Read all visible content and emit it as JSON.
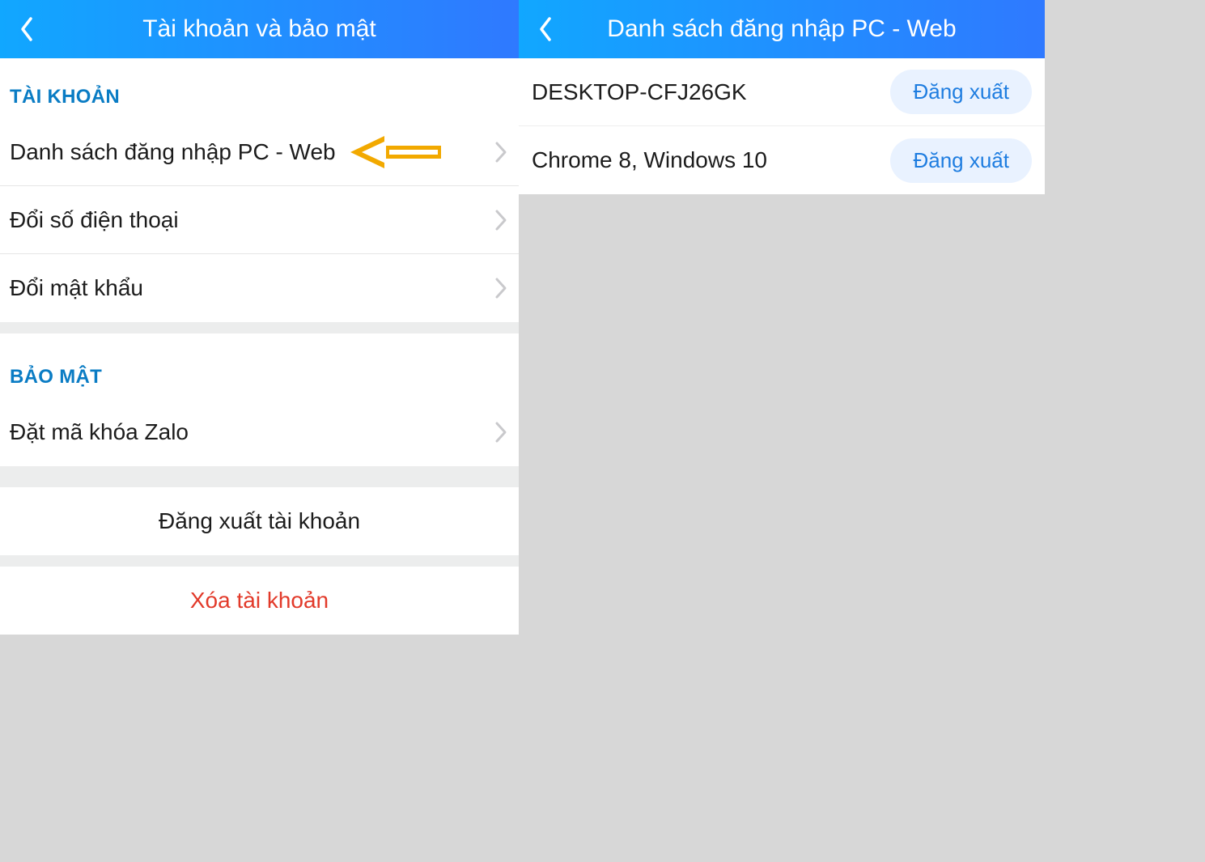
{
  "left": {
    "header_title": "Tài khoản và bảo mật",
    "section_account": "TÀI KHOẢN",
    "rows_account": [
      {
        "label": "Danh sách đăng nhập PC - Web",
        "annotated": true
      },
      {
        "label": "Đổi số điện thoại"
      },
      {
        "label": "Đổi mật khẩu"
      }
    ],
    "section_security": "BẢO MẬT",
    "rows_security": [
      {
        "label": "Đặt mã khóa Zalo"
      }
    ],
    "logout_label": "Đăng xuất tài khoản",
    "delete_label": "Xóa tài khoản"
  },
  "right": {
    "header_title": "Danh sách đăng nhập PC - Web",
    "logout_button": "Đăng xuất",
    "devices": [
      {
        "name": "DESKTOP-CFJ26GK"
      },
      {
        "name": "Chrome 8, Windows 10"
      }
    ]
  },
  "colors": {
    "header_gradient_from": "#11a7ff",
    "header_gradient_to": "#2f79ff",
    "section_text": "#0a7cc4",
    "danger": "#e23a2a",
    "pill_bg": "#e9f2ff",
    "pill_text": "#1e7de0",
    "annotation_arrow": "#f2a900"
  }
}
